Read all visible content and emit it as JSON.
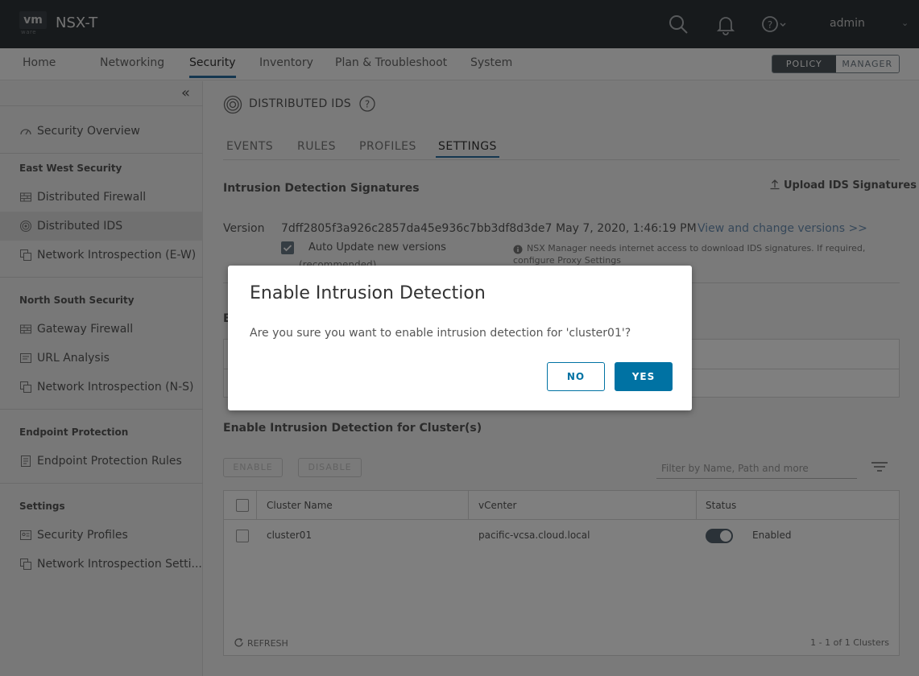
{
  "header": {
    "logo_text": "vm",
    "logo_sub": "ware",
    "product": "NSX-T",
    "user": "admin"
  },
  "nav": {
    "items": [
      "Home",
      "Networking",
      "Security",
      "Inventory",
      "Plan & Troubleshoot",
      "System"
    ],
    "active": "Security",
    "mode_policy": "POLICY",
    "mode_manager": "MANAGER"
  },
  "sidebar": {
    "overview": "Security Overview",
    "groups": [
      {
        "heading": "East West Security",
        "items": [
          "Distributed Firewall",
          "Distributed IDS",
          "Network Introspection (E-W)"
        ]
      },
      {
        "heading": "North South Security",
        "items": [
          "Gateway Firewall",
          "URL Analysis",
          "Network Introspection (N-S)"
        ]
      },
      {
        "heading": "Endpoint Protection",
        "items": [
          "Endpoint Protection Rules"
        ]
      },
      {
        "heading": "Settings",
        "items": [
          "Security Profiles",
          "Network Introspection Setti..."
        ]
      }
    ],
    "active": "Distributed IDS"
  },
  "page": {
    "title": "DISTRIBUTED IDS",
    "tabs": [
      "EVENTS",
      "RULES",
      "PROFILES",
      "SETTINGS"
    ],
    "active_tab": "SETTINGS"
  },
  "signatures": {
    "heading": "Intrusion Detection Signatures",
    "upload_label": "Upload IDS Signatures",
    "version_label": "Version",
    "version_hash": "7dff2805f3a926c2857da45e936c7bb3df8d3de7",
    "version_date": "May 7, 2020, 1:46:19 PM",
    "version_link": "View and change versions >>",
    "auto_update_label": "Auto Update new versions",
    "auto_update_hint": "(recommended)",
    "auto_update_checked": true,
    "note": "NSX Manager needs internet access to download IDS signatures. If required, configure Proxy Settings"
  },
  "hidden_heading_initial": "E",
  "clusters": {
    "heading": "Enable Intrusion Detection for Cluster(s)",
    "enable_label": "ENABLE",
    "disable_label": "DISABLE",
    "filter_placeholder": "Filter by Name, Path and more",
    "columns": [
      "Cluster Name",
      "vCenter",
      "Status"
    ],
    "rows": [
      {
        "name": "cluster01",
        "vcenter": "pacific-vcsa.cloud.local",
        "status": "Enabled",
        "enabled": true
      }
    ],
    "refresh_label": "REFRESH",
    "count_label": "1 - 1 of 1 Clusters"
  },
  "modal": {
    "title": "Enable Intrusion Detection",
    "message": "Are you sure you want to enable intrusion detection for 'cluster01'?",
    "no_label": "NO",
    "yes_label": "YES"
  },
  "colors": {
    "header_bg": "#2e3438",
    "accent": "#0072a3",
    "overlay": "rgba(0,0,0,0.5)"
  }
}
